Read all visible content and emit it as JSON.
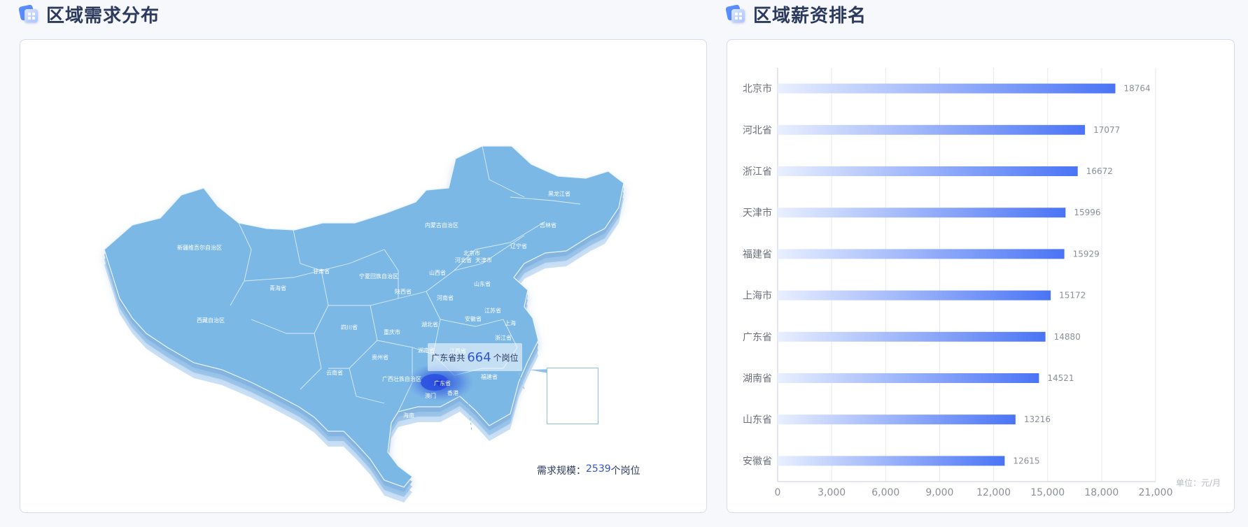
{
  "map_panel": {
    "title": "区域需求分布",
    "tooltip": {
      "prefix": "广东省共",
      "value": "664",
      "suffix": "个岗位"
    },
    "demand": {
      "label": "需求规模：",
      "value": "2539",
      "suffix": "个岗位"
    },
    "province_labels": [
      {
        "name": "黑龙江省"
      },
      {
        "name": "吉林省"
      },
      {
        "name": "辽宁省"
      },
      {
        "name": "内蒙古自治区"
      },
      {
        "name": "北京市"
      },
      {
        "name": "天津市"
      },
      {
        "name": "河北省"
      },
      {
        "name": "山西省"
      },
      {
        "name": "山东省"
      },
      {
        "name": "河南省"
      },
      {
        "name": "江苏省"
      },
      {
        "name": "安徽省"
      },
      {
        "name": "上海"
      },
      {
        "name": "浙江省"
      },
      {
        "name": "湖北省"
      },
      {
        "name": "江西省"
      },
      {
        "name": "湖南省"
      },
      {
        "name": "福建省"
      },
      {
        "name": "新疆维吾尔自治区"
      },
      {
        "name": "青海省"
      },
      {
        "name": "甘肃省"
      },
      {
        "name": "宁夏回族自治区"
      },
      {
        "name": "陕西省"
      },
      {
        "name": "西藏自治区"
      },
      {
        "name": "四川省"
      },
      {
        "name": "重庆市"
      },
      {
        "name": "贵州省"
      },
      {
        "name": "云南省"
      },
      {
        "name": "广西壮族自治区"
      },
      {
        "name": "广东省"
      },
      {
        "name": "香港"
      },
      {
        "name": "澳门"
      },
      {
        "name": "海南"
      }
    ],
    "colors": {
      "map_fill": "#7cb8e6",
      "highlight": "#3d6be0"
    }
  },
  "bar_panel": {
    "title": "区域薪资排名",
    "unit": "单位：元/月"
  },
  "chart_data": {
    "type": "bar",
    "orientation": "horizontal",
    "categories": [
      "北京市",
      "河北省",
      "浙江省",
      "天津市",
      "福建省",
      "上海市",
      "广东省",
      "湖南省",
      "山东省",
      "安徽省"
    ],
    "values": [
      18764,
      17077,
      16672,
      15996,
      15929,
      15172,
      14880,
      14521,
      13216,
      12615
    ],
    "xlim": [
      0,
      21000
    ],
    "xticks": [
      "0",
      "3,000",
      "6,000",
      "9,000",
      "12,000",
      "15,000",
      "18,000",
      "21,000"
    ],
    "grid": true,
    "colors": {
      "bar_start": "#e8efff",
      "bar_end": "#4a74f5"
    }
  }
}
